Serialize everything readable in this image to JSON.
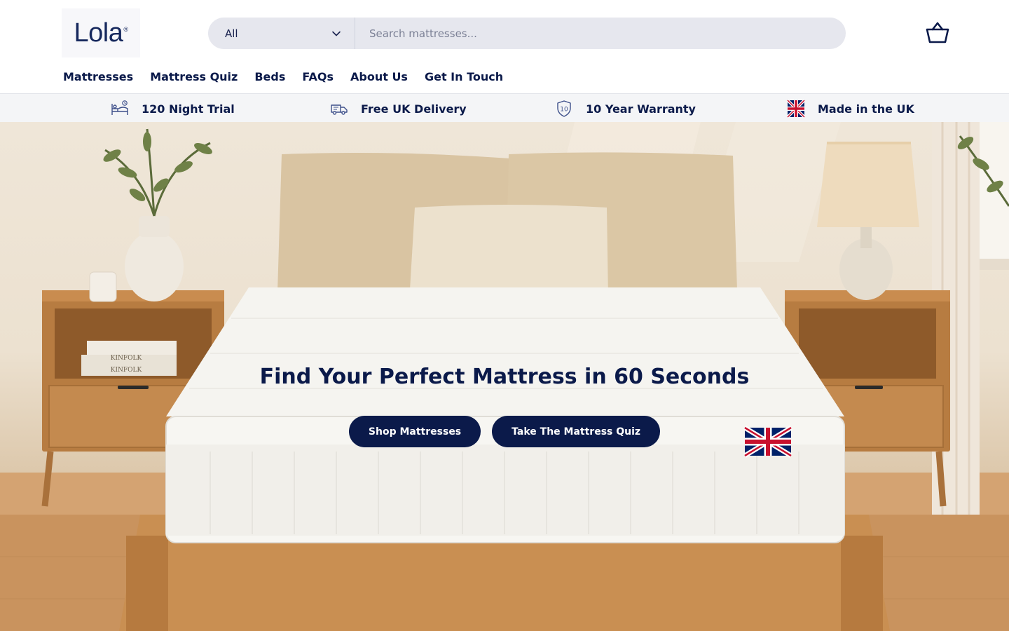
{
  "brand": {
    "name": "Lola",
    "reg": "®",
    "primary_color": "#0b1a4a"
  },
  "search": {
    "category": "All",
    "placeholder": "Search mattresses..."
  },
  "nav": {
    "items": [
      {
        "label": "Mattresses"
      },
      {
        "label": "Mattress Quiz"
      },
      {
        "label": "Beds"
      },
      {
        "label": "FAQs"
      },
      {
        "label": "About Us"
      },
      {
        "label": "Get In Touch"
      }
    ]
  },
  "usp": {
    "items": [
      {
        "label": "120 Night Trial",
        "icon": "sleeping-bed-icon"
      },
      {
        "label": "Free UK Delivery",
        "icon": "delivery-truck-icon"
      },
      {
        "label": "10 Year Warranty",
        "icon": "shield-10-icon",
        "badge": "10"
      },
      {
        "label": "Made in the UK",
        "icon": "uk-flag-icon"
      }
    ]
  },
  "hero": {
    "title": "Find Your Perfect Mattress in 60 Seconds",
    "primary_button": "Shop Mattresses",
    "secondary_button": "Take The Mattress Quiz",
    "book_spine_1": "KINFOLK",
    "book_spine_2": "KINFOLK"
  },
  "icons": {
    "cart": "basket-icon",
    "chevron": "chevron-down-icon"
  }
}
